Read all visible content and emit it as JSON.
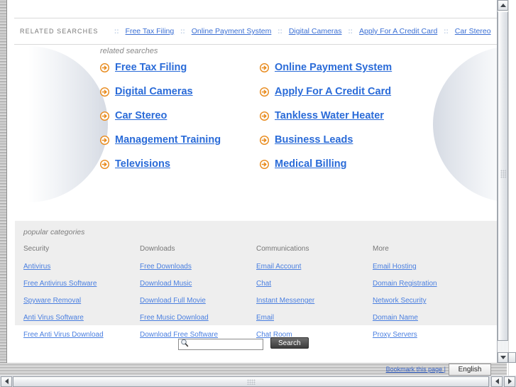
{
  "topbar": {
    "label": "RELATED SEARCHES",
    "separator": "::",
    "links": [
      "Free Tax Filing",
      "Online Payment System",
      "Digital Cameras",
      "Apply For A Credit Card",
      "Car Stereo"
    ]
  },
  "related": {
    "heading": "related searches",
    "icon": "arrow-circle-right-icon",
    "items": [
      "Free Tax Filing",
      "Online Payment System",
      "Digital Cameras",
      "Apply For A Credit Card",
      "Car Stereo",
      "Tankless Water Heater",
      "Management Training",
      "Business Leads",
      "Televisions",
      "Medical Billing"
    ]
  },
  "categories": {
    "heading": "popular categories",
    "columns": [
      {
        "title": "Security",
        "links": [
          "Antivirus",
          "Free Antivirus Software",
          "Spyware Removal",
          "Anti Virus Software",
          "Free Anti Virus Download"
        ]
      },
      {
        "title": "Downloads",
        "links": [
          "Free Downloads",
          "Download Music",
          "Download Full Movie",
          "Free Music Download",
          "Download Free Software"
        ]
      },
      {
        "title": "Communications",
        "links": [
          "Email Account",
          "Chat",
          "Instant Messenger",
          "Email",
          "Chat Room"
        ]
      },
      {
        "title": "More",
        "links": [
          "Email Hosting",
          "Domain Registration",
          "Network Security",
          "Domain Name",
          "Proxy Servers"
        ]
      }
    ]
  },
  "search": {
    "value": "",
    "placeholder": "",
    "button_label": "Search",
    "icon": "magnifier-icon"
  },
  "footer": {
    "bookmark_label": "Bookmark this page |",
    "language": "English"
  },
  "colors": {
    "link_blue": "#2a6bd8",
    "small_link_blue": "#4a7fe0",
    "accent_orange": "#e8891a",
    "category_bg": "#eeeeee",
    "muted_text": "#7d7d7d"
  }
}
